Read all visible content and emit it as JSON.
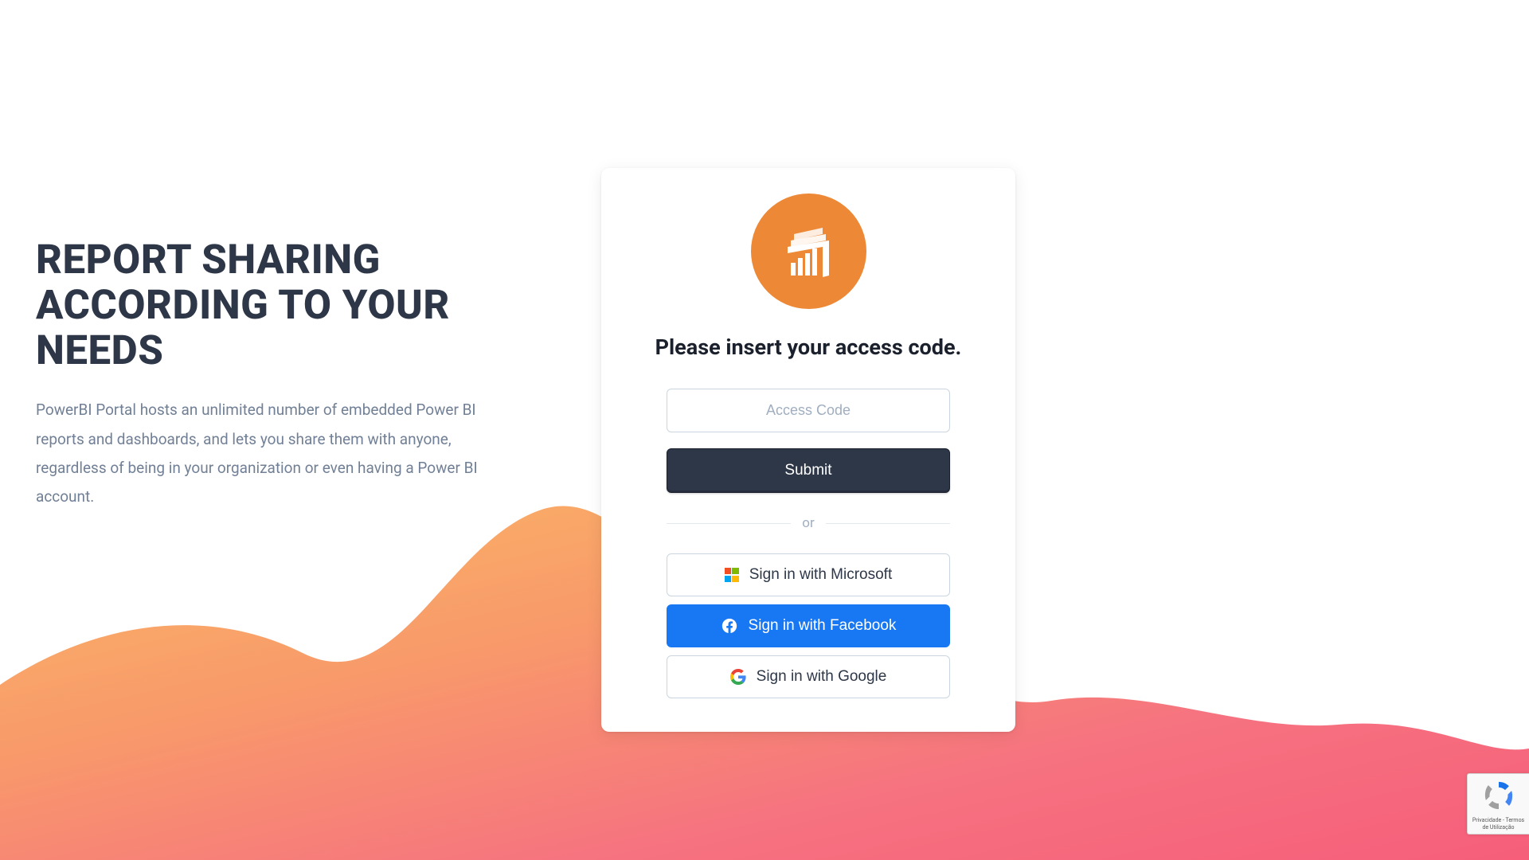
{
  "hero": {
    "title": "REPORT SHARING ACCORDING TO YOUR NEEDS",
    "description": "PowerBI Portal hosts an unlimited number of embedded Power BI reports and dashboards, and lets you share them with anyone, regardless of being in your organization or even having a Power BI account."
  },
  "card": {
    "heading": "Please insert your access code.",
    "access_placeholder": "Access Code",
    "submit_label": "Submit",
    "divider_text": "or",
    "sso": {
      "microsoft_label": "Sign in with Microsoft",
      "facebook_label": "Sign in with Facebook",
      "google_label": "Sign in with Google"
    }
  },
  "recaptcha": {
    "privacy_terms": "Privacidade - Termos de Utilização"
  },
  "colors": {
    "brand_orange": "#ed8936",
    "dark_slate": "#2d3748",
    "facebook_blue": "#1877f2"
  }
}
